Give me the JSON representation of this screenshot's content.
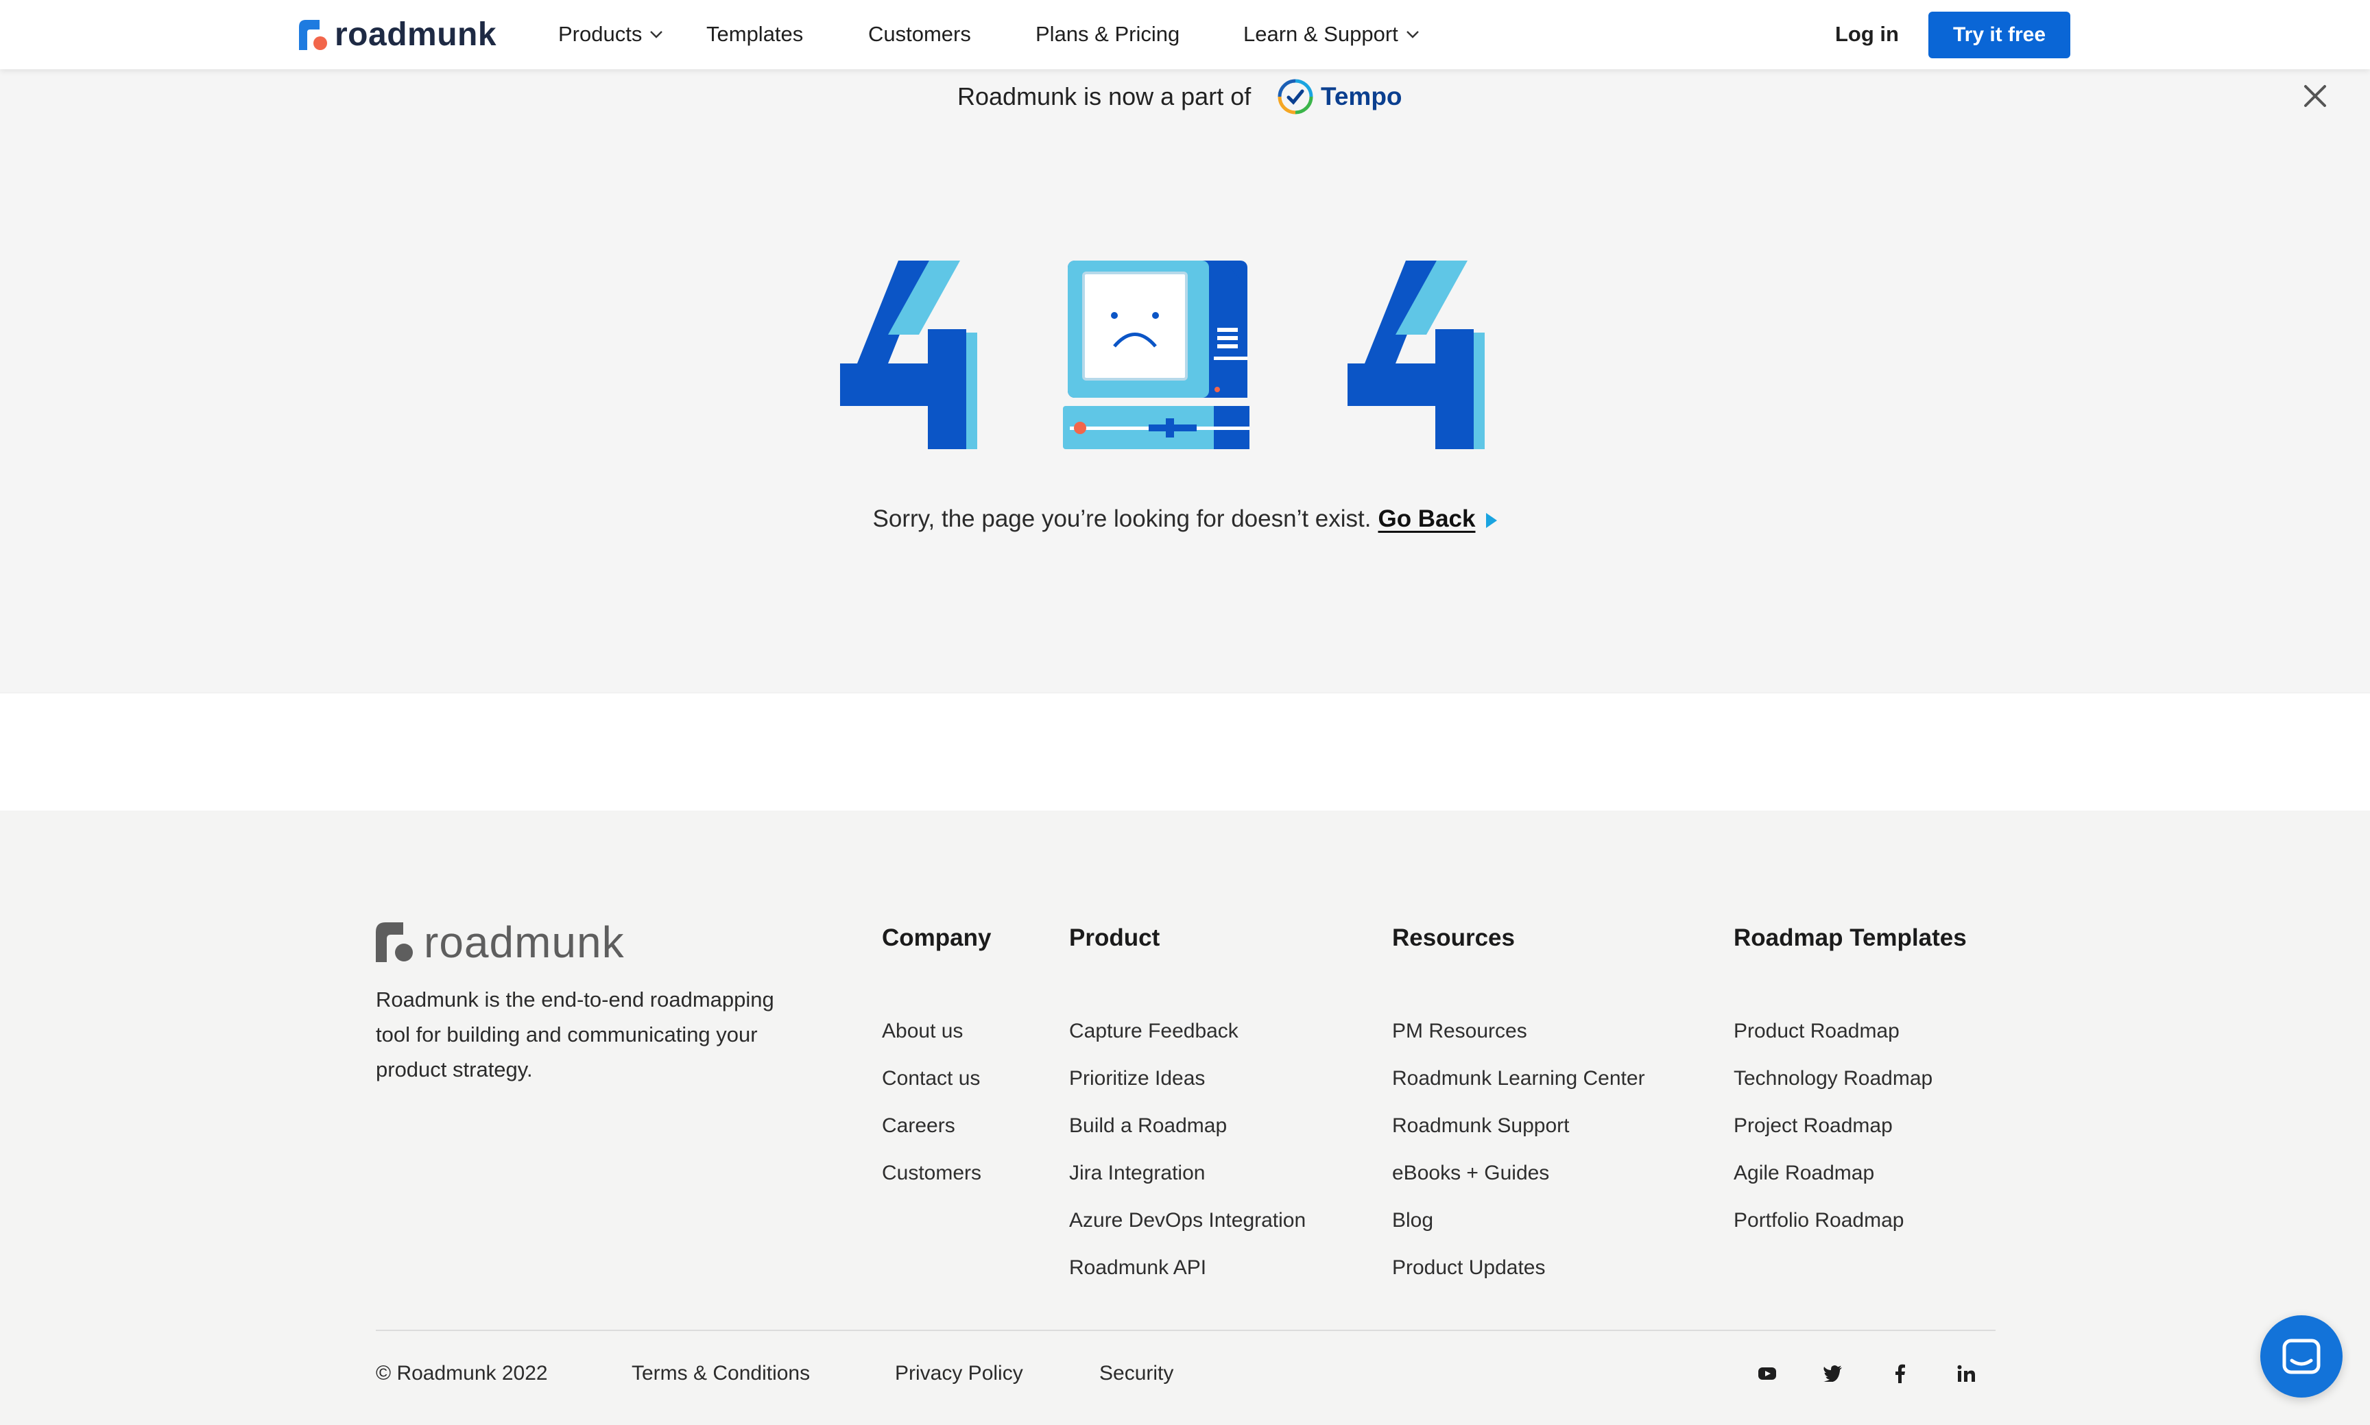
{
  "header": {
    "logo_text": "roadmunk",
    "nav": [
      {
        "label": "Products",
        "dropdown": true
      },
      {
        "label": "Templates",
        "dropdown": false
      },
      {
        "label": "Customers",
        "dropdown": false
      },
      {
        "label": "Plans & Pricing",
        "dropdown": false
      },
      {
        "label": "Learn & Support",
        "dropdown": true
      }
    ],
    "login_label": "Log in",
    "cta_label": "Try it free"
  },
  "banner": {
    "text": "Roadmunk is now a part of",
    "partner": "Tempo",
    "close_icon": "close-icon"
  },
  "error": {
    "code": "404",
    "message": "Sorry, the page you’re looking for doesn’t exist.",
    "link_label": "Go Back"
  },
  "footer": {
    "logo_text": "roadmunk",
    "description": "Roadmunk is the end-to-end roadmapping tool for building and communicating your product strategy.",
    "columns": [
      {
        "title": "Company",
        "links": [
          "About us",
          "Contact us",
          "Careers",
          "Customers"
        ]
      },
      {
        "title": "Product",
        "links": [
          "Capture Feedback",
          "Prioritize Ideas",
          "Build a Roadmap",
          "Jira Integration",
          "Azure DevOps Integration",
          "Roadmunk API"
        ]
      },
      {
        "title": "Resources",
        "links": [
          "PM Resources",
          "Roadmunk Learning Center",
          "Roadmunk Support",
          "eBooks + Guides",
          "Blog",
          "Product Updates"
        ]
      },
      {
        "title": "Roadmap Templates",
        "links": [
          "Product Roadmap",
          "Technology Roadmap",
          "Project Roadmap",
          "Agile Roadmap",
          "Portfolio Roadmap"
        ]
      }
    ],
    "copyright": "© Roadmunk 2022",
    "legal_links": [
      "Terms & Conditions",
      "Privacy Policy",
      "Security"
    ],
    "social": [
      "youtube-icon",
      "twitter-icon",
      "facebook-icon",
      "linkedin-icon"
    ]
  },
  "colors": {
    "brand_blue": "#0a66d6",
    "art_dark_blue": "#0b55c6",
    "art_light_blue": "#5fc6e6",
    "accent_orange": "#f2664b",
    "link_arrow": "#1aa4e0"
  },
  "chat_widget_icon": "chat-icon"
}
